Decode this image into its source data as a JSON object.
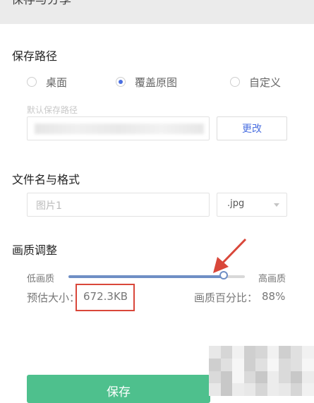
{
  "header": {
    "title": "保存与分享"
  },
  "save_path": {
    "title": "保存路径",
    "options": [
      {
        "label": "桌面",
        "checked": false
      },
      {
        "label": "覆盖原图",
        "checked": true
      },
      {
        "label": "自定义",
        "checked": false
      }
    ],
    "default_label": "默认保存路径",
    "change_label": "更改"
  },
  "file": {
    "title": "文件名与格式",
    "name_placeholder": "图片1",
    "format": ".jpg"
  },
  "quality": {
    "title": "画质调整",
    "low_label": "低画质",
    "high_label": "高画质",
    "level_percent": 88,
    "estimate_label": "预估大小：",
    "estimate_value": "672.3KB",
    "percent_label": "画质百分比：",
    "percent_value": "88%"
  },
  "save_button": "保存",
  "colors": {
    "accent": "#4a6fe0",
    "slider": "#6f8fc5",
    "save": "#4ec08d",
    "annotation": "#d9473a"
  }
}
